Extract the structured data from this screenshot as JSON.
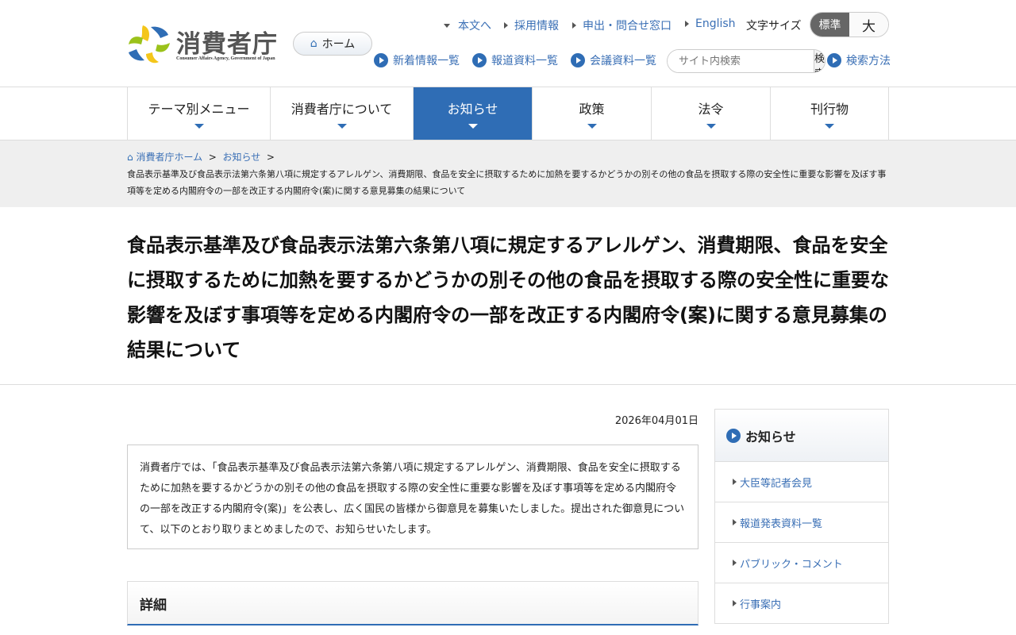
{
  "header": {
    "logo_text": "消費者庁",
    "logo_sub": "Consumer Affairs Agency, Government of Japan",
    "home": "ホーム",
    "util_links": [
      "本文へ",
      "採用情報",
      "申出・問合せ窓口",
      "English"
    ],
    "font_size_label": "文字サイズ",
    "font_size_standard": "標準",
    "font_size_large": "大",
    "sub_links": [
      "新着情報一覧",
      "報道資料一覧",
      "会議資料一覧"
    ],
    "search_placeholder": "サイト内検索",
    "search_button": "検索",
    "search_help": "検索方法"
  },
  "nav": [
    "テーマ別メニュー",
    "消費者庁について",
    "お知らせ",
    "政策",
    "法令",
    "刊行物"
  ],
  "breadcrumb": {
    "home": "消費者庁ホーム",
    "section": "お知らせ",
    "current": "食品表示基準及び食品表示法第六条第八項に規定するアレルゲン、消費期限、食品を安全に摂取するために加熱を要するかどうかの別その他の食品を摂取する際の安全性に重要な影響を及ぼす事項等を定める内閣府令の一部を改正する内閣府令(案)に関する意見募集の結果について"
  },
  "title": "食品表示基準及び食品表示法第六条第八項に規定するアレルゲン、消費期限、食品を安全に摂取するために加熱を要するかどうかの別その他の食品を摂取する際の安全性に重要な影響を及ぼす事項等を定める内閣府令の一部を改正する内閣府令(案)に関する意見募集の結果について",
  "date": "2026年04月01日",
  "lead": "消費者庁では、「食品表示基準及び食品表示法第六条第八項に規定するアレルゲン、消費期限、食品を安全に摂取するために加熱を要するかどうかの別その他の食品を摂取する際の安全性に重要な影響を及ぼす事項等を定める内閣府令の一部を改正する内閣府令(案)」を公表し、広く国民の皆様から御意見を募集いたしました。提出された御意見について、以下のとおり取りまとめましたので、お知らせいたします。",
  "detail_heading": "詳細",
  "sidebar": {
    "heading": "お知らせ",
    "items": [
      "大臣等記者会見",
      "報道発表資料一覧",
      "パブリック・コメント",
      "行事案内"
    ]
  }
}
